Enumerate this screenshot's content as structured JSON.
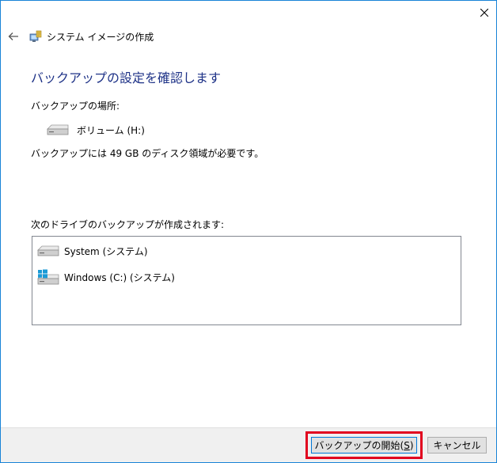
{
  "window": {
    "title": "システム イメージの作成"
  },
  "main": {
    "heading": "バックアップの設定を確認します",
    "location_label": "バックアップの場所:",
    "location_item": "ボリューム (H:)",
    "size_text": "バックアップには 49 GB のディスク領域が必要です。",
    "drives_label": "次のドライブのバックアップが作成されます:",
    "drives": [
      {
        "label": "System (システム)",
        "icon": "drive-icon"
      },
      {
        "label": "Windows (C:) (システム)",
        "icon": "windows-drive-icon"
      }
    ]
  },
  "footer": {
    "start_label": "バックアップの開始(",
    "start_accel": "S",
    "start_label_end": ")",
    "cancel_label": "キャンセル"
  },
  "colors": {
    "heading": "#1e3287",
    "window_border": "#1883d7",
    "highlight": "#e1001e",
    "footer_bg": "#f0f0f0"
  }
}
